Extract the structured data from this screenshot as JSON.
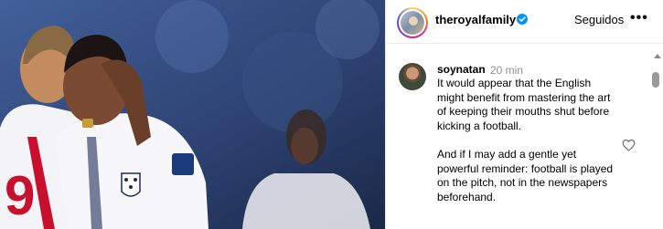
{
  "post": {
    "account": {
      "username": "theroyalfamily",
      "verified": true,
      "follow_label": "Seguidos",
      "more_icon": "more-horizontal-icon"
    },
    "photo": {
      "jersey_number": "9"
    }
  },
  "comments": [
    {
      "author": "soynatan",
      "time": "20 min",
      "text": "It would appear that the English might benefit from mastering the art of keeping their mouths shut before kicking a football.\n\nAnd if I may add a gentle yet powerful reminder: football is played on the pitch, not in the newspapers beforehand.",
      "like_icon": "heart-outline-icon"
    }
  ],
  "colors": {
    "verified_badge": "#0095f6",
    "jersey_red": "#c8102e",
    "stadium_blue": "#2a3e68"
  }
}
